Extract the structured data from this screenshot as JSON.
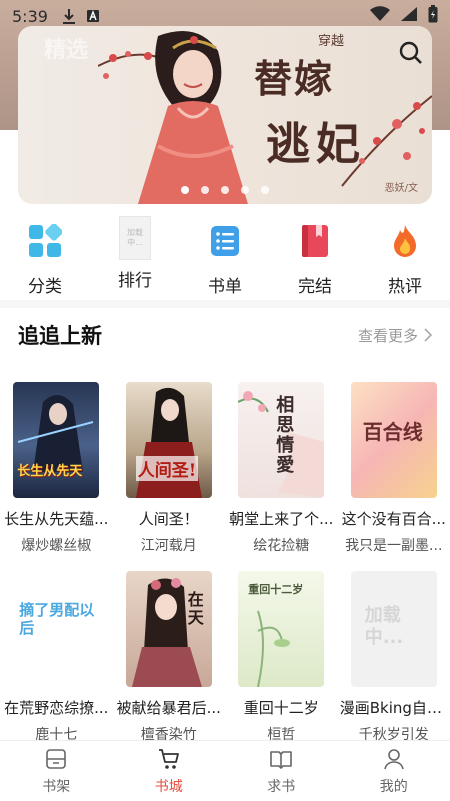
{
  "status_bar": {
    "time": "5:39"
  },
  "banner": {
    "title_line1": "替嫁",
    "title_line2": "逃妃",
    "small_text": "穿越",
    "author_mark": "恶妖/文",
    "ghost_text": "精选",
    "dot_count": 5
  },
  "categories": [
    {
      "label": "分类",
      "icon": "grid-icon"
    },
    {
      "label": "排行",
      "icon": "loading-placeholder-icon",
      "placeholder": "加载中..."
    },
    {
      "label": "书单",
      "icon": "list-icon"
    },
    {
      "label": "完结",
      "icon": "bookmark-book-icon"
    },
    {
      "label": "热评",
      "icon": "flame-icon"
    }
  ],
  "section": {
    "title": "追追上新",
    "more": "查看更多"
  },
  "books": [
    {
      "title": "长生从先天蕴...",
      "author": "爆炒螺丝椒",
      "cover_text": "长生从先天",
      "cover_bg": "#3b4a66"
    },
    {
      "title": "人间圣！",
      "author": "江河载月",
      "cover_text": "人间圣!",
      "cover_bg": "#c7b59a"
    },
    {
      "title": "朝堂上来了个...",
      "author": "绘花捡糖",
      "cover_text": "相思情愛",
      "cover_bg": "#f3e8e6"
    },
    {
      "title": "这个没有百合...",
      "author": "我只是一副墨...",
      "cover_text": "百合线",
      "cover_bg": "#f7c9a8"
    },
    {
      "title": "在荒野恋综撩...",
      "author": "鹿十七",
      "cover_text": "摘了男配以后",
      "cover_bg": "#ffffff"
    },
    {
      "title": "被献给暴君后...",
      "author": "檀香染竹",
      "cover_text": "在天",
      "cover_bg": "#d8c2b6"
    },
    {
      "title": "重回十二岁",
      "author": "桓哲",
      "cover_text": "重回十二岁",
      "cover_bg": "#eaf1d9"
    },
    {
      "title": "漫画Bking自救...",
      "author": "千秋岁引发",
      "cover_text": "加载中...",
      "cover_bg": "#f0f0f0"
    }
  ],
  "bottom_nav": [
    {
      "label": "书架",
      "icon": "bookshelf-icon",
      "active": false
    },
    {
      "label": "书城",
      "icon": "cart-icon",
      "active": true
    },
    {
      "label": "求书",
      "icon": "open-book-icon",
      "active": false
    },
    {
      "label": "我的",
      "icon": "person-icon",
      "active": false
    }
  ],
  "colors": {
    "accent": "#e84a3c",
    "banner_bg": "#c9ad9d"
  }
}
